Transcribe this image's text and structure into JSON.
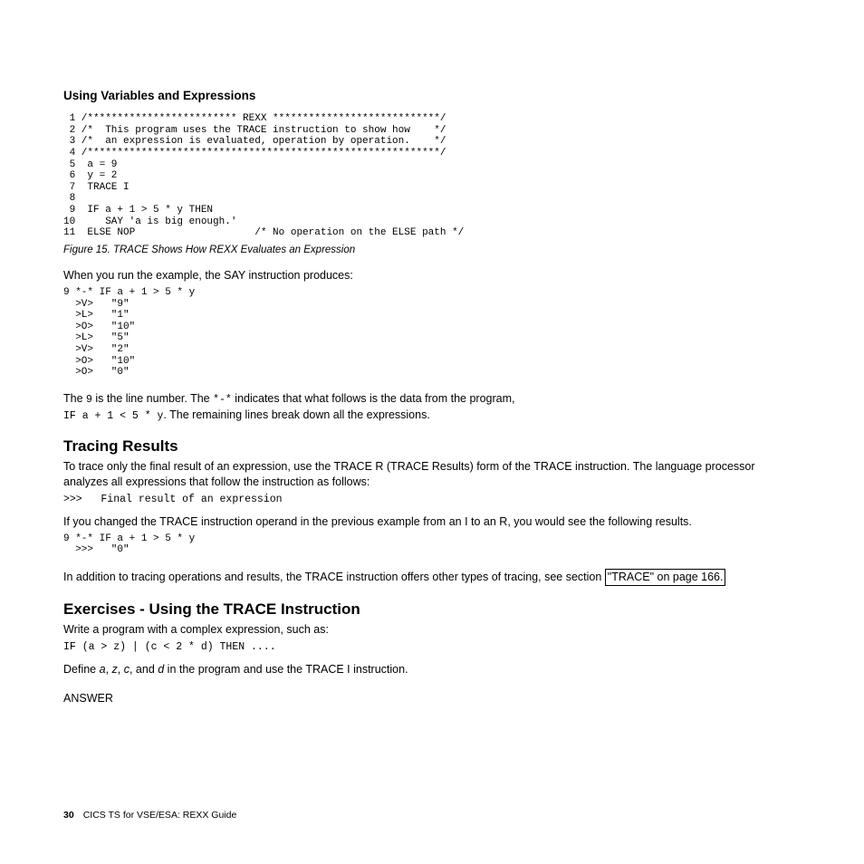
{
  "section1_title": "Using Variables and Expressions",
  "code1": " 1 /************************* REXX ****************************/\n 2 /*  This program uses the TRACE instruction to show how    */\n 3 /*  an expression is evaluated, operation by operation.    */\n 4 /***********************************************************/\n 5  a = 9\n 6  y = 2\n 7  TRACE I\n 8\n 9  IF a + 1 > 5 * y THEN\n10     SAY 'a is big enough.'\n11  ELSE NOP                    /* No operation on the ELSE path */",
  "figure_label": "Figure 15. TRACE Shows How REXX Evaluates an Expression",
  "p1": "When you run the example, the SAY instruction produces:",
  "code2": "9 *-* IF a + 1 > 5 * y\n  >V>   \"9\"\n  >L>   \"1\"\n  >O>   \"10\"\n  >L>   \"5\"\n  >V>   \"2\"\n  >O>   \"10\"\n  >O>   \"0\"",
  "p2a": "The ",
  "p2b": "9",
  "p2c": " is the line number. The ",
  "p2d": "*-*",
  "p2e": " indicates that what follows is the data from the program,",
  "p2f": "IF a + 1 < 5 * y",
  "p2g": ". The remaining lines break down all the expressions.",
  "h2_1": "Tracing Results",
  "p3": "To trace only the final result of an expression, use the TRACE R (TRACE Results) form of the TRACE instruction. The language processor analyzes all expressions that follow the instruction as follows:",
  "code3": ">>>   Final result of an expression",
  "p4": "If you changed the TRACE instruction operand in the previous example from an I to an R, you would see the following results.",
  "code4": "9 *-* IF a + 1 > 5 * y\n  >>>   \"0\"",
  "p5a": "In addition to tracing operations and results, the TRACE instruction offers other types of tracing, see section ",
  "p5_link": "\"TRACE\" on page 166.",
  "h2_2": "Exercises - Using the TRACE Instruction",
  "p6": "Write a program with a complex expression, such as:",
  "code5": "IF (a > z) | (c < 2 * d) THEN ....",
  "p7_pre": "Define ",
  "p7_a": "a",
  "p7_sep1": ", ",
  "p7_z": "z",
  "p7_sep2": ", ",
  "p7_c": "c",
  "p7_sep3": ", and ",
  "p7_d": "d",
  "p7_post": " in the program and use the TRACE I instruction.",
  "answer": "ANSWER",
  "footer_page": "30",
  "footer_text": "CICS TS for VSE/ESA:  REXX Guide"
}
